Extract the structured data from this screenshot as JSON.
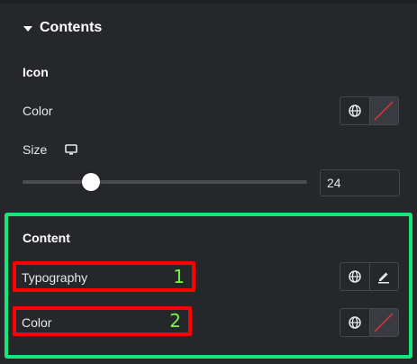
{
  "section": {
    "title": "Contents"
  },
  "icon_group": {
    "heading": "Icon",
    "color_label": "Color",
    "size_label": "Size",
    "size_value": "24",
    "slider_fraction": 0.24
  },
  "content_group": {
    "heading": "Content",
    "typography_label": "Typography",
    "typography_number": "1",
    "color_label": "Color",
    "color_number": "2"
  },
  "icons": {
    "caret": "caret-down-icon",
    "globe": "globe-icon",
    "no_color": "no-color-slash-icon",
    "pencil": "pencil-icon",
    "monitor": "desktop-monitor-icon"
  },
  "colors": {
    "background": "#26272b",
    "highlight_green": "#14e87c",
    "annotation_red": "#ff0000",
    "annotation_number": "#7cf44a",
    "slash_red": "#d9363e"
  }
}
